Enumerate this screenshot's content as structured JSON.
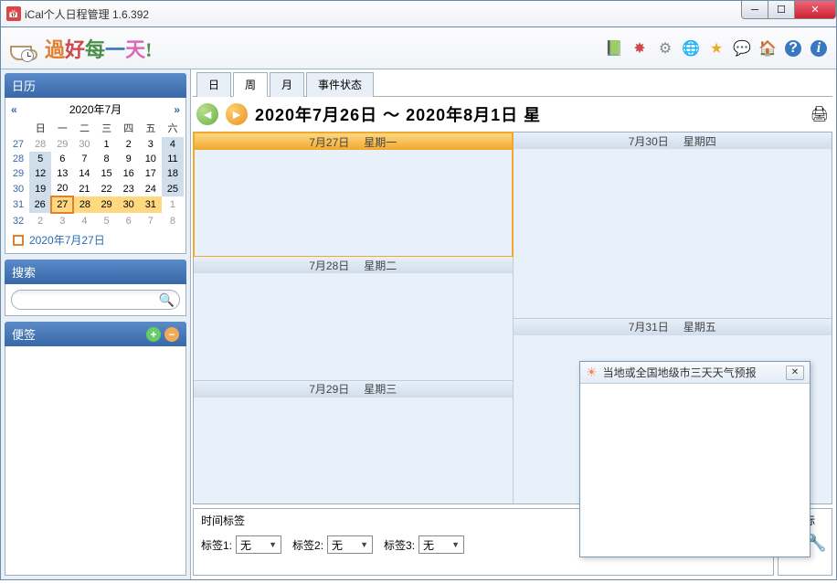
{
  "window": {
    "title": "iCal个人日程管理    1.6.392"
  },
  "logo": {
    "c1": "過",
    "c2": "好",
    "c3": "每",
    "c4": "一",
    "c5": "天",
    "bang": "!"
  },
  "toolbar_icons": [
    "book",
    "spark",
    "gear",
    "globe",
    "star",
    "chat",
    "home",
    "help",
    "info"
  ],
  "sidebar": {
    "calendar": {
      "title": "日历",
      "month_label": "2020年7月",
      "prev": "«",
      "next": "»",
      "dow": [
        "日",
        "一",
        "二",
        "三",
        "四",
        "五",
        "六"
      ],
      "rows": [
        {
          "wn": "27",
          "days": [
            {
              "n": "28",
              "cls": "om"
            },
            {
              "n": "29",
              "cls": "om"
            },
            {
              "n": "30",
              "cls": "om"
            },
            {
              "n": "1",
              "cls": ""
            },
            {
              "n": "2",
              "cls": ""
            },
            {
              "n": "3",
              "cls": ""
            },
            {
              "n": "4",
              "cls": "we"
            }
          ]
        },
        {
          "wn": "28",
          "days": [
            {
              "n": "5",
              "cls": "we"
            },
            {
              "n": "6",
              "cls": ""
            },
            {
              "n": "7",
              "cls": ""
            },
            {
              "n": "8",
              "cls": ""
            },
            {
              "n": "9",
              "cls": ""
            },
            {
              "n": "10",
              "cls": ""
            },
            {
              "n": "11",
              "cls": "we"
            }
          ]
        },
        {
          "wn": "29",
          "days": [
            {
              "n": "12",
              "cls": "we"
            },
            {
              "n": "13",
              "cls": ""
            },
            {
              "n": "14",
              "cls": ""
            },
            {
              "n": "15",
              "cls": ""
            },
            {
              "n": "16",
              "cls": ""
            },
            {
              "n": "17",
              "cls": ""
            },
            {
              "n": "18",
              "cls": "we"
            }
          ]
        },
        {
          "wn": "30",
          "days": [
            {
              "n": "19",
              "cls": "we"
            },
            {
              "n": "20",
              "cls": ""
            },
            {
              "n": "21",
              "cls": ""
            },
            {
              "n": "22",
              "cls": ""
            },
            {
              "n": "23",
              "cls": ""
            },
            {
              "n": "24",
              "cls": ""
            },
            {
              "n": "25",
              "cls": "we"
            }
          ]
        },
        {
          "wn": "31",
          "days": [
            {
              "n": "26",
              "cls": "we"
            },
            {
              "n": "27",
              "cls": "today"
            },
            {
              "n": "28",
              "cls": "sel"
            },
            {
              "n": "29",
              "cls": "sel"
            },
            {
              "n": "30",
              "cls": "sel"
            },
            {
              "n": "31",
              "cls": "sel"
            },
            {
              "n": "1",
              "cls": "om"
            }
          ]
        },
        {
          "wn": "32",
          "days": [
            {
              "n": "2",
              "cls": "om"
            },
            {
              "n": "3",
              "cls": "om"
            },
            {
              "n": "4",
              "cls": "om"
            },
            {
              "n": "5",
              "cls": "om"
            },
            {
              "n": "6",
              "cls": "om"
            },
            {
              "n": "7",
              "cls": "om"
            },
            {
              "n": "8",
              "cls": "om"
            }
          ]
        }
      ],
      "footer_date": "2020年7月27日"
    },
    "search": {
      "title": "搜索",
      "placeholder": ""
    },
    "notes": {
      "title": "便签"
    }
  },
  "tabs": {
    "day": "日",
    "week": "周",
    "month": "月",
    "status": "事件状态"
  },
  "nav": {
    "range": "2020年7月26日 ～ 2020年8月1日 星"
  },
  "week_days": [
    [
      {
        "date": "7月27日",
        "dow": "星期一",
        "today": true
      },
      {
        "date": "7月28日",
        "dow": "星期二",
        "today": false
      },
      {
        "date": "7月29日",
        "dow": "星期三",
        "today": false
      }
    ],
    [
      {
        "date": "7月30日",
        "dow": "星期四",
        "today": false
      },
      {
        "date": "7月31日",
        "dow": "星期五",
        "today": false
      }
    ]
  ],
  "bottom": {
    "time_tags_title": "时间标签",
    "tags": [
      {
        "label": "标签1:",
        "value": "无"
      },
      {
        "label": "标签2:",
        "value": "无"
      },
      {
        "label": "标签3:",
        "value": "无"
      }
    ],
    "icon_tags_title": "图标标"
  },
  "weather": {
    "title": "当地或全国地级市三天天气预报"
  }
}
